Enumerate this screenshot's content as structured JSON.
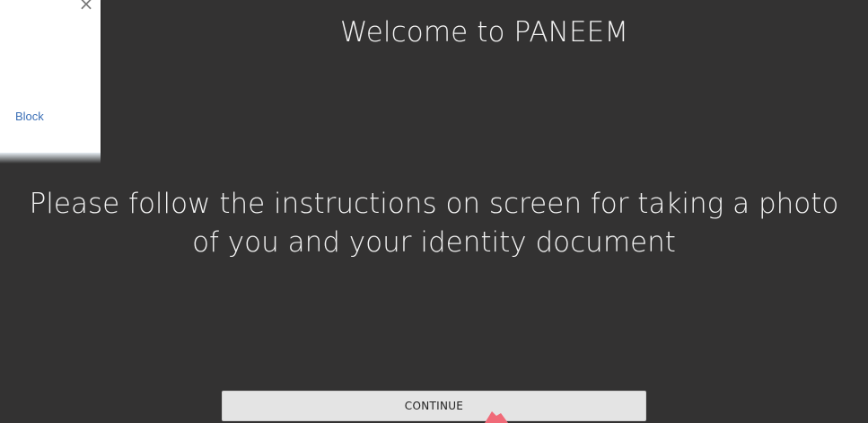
{
  "popup": {
    "close_symbol": "×",
    "block_label": "Block"
  },
  "main": {
    "title": "Welcome to PANEEM",
    "instructions_line1": "Please follow the instructions on screen for taking a photo",
    "instructions_line2": "of you and your identity document",
    "continue_label": "CONTINUE"
  },
  "colors": {
    "background": "#333232",
    "text": "#f2f2f2",
    "button": "#e4e4e4",
    "link": "#3b6fb6",
    "pointer": "#f06a78"
  },
  "icons": {
    "popup_close": "close-icon",
    "pointer": "arrow-pointer-icon"
  }
}
